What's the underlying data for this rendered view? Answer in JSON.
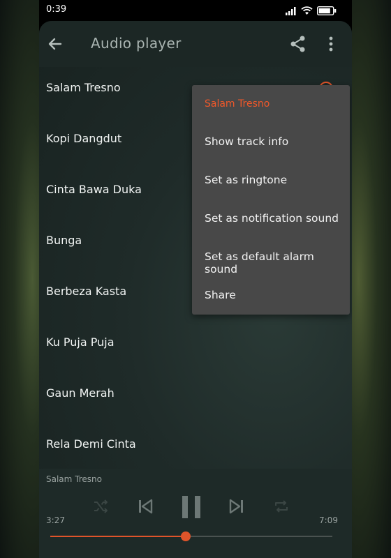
{
  "status_bar": {
    "time": "0:39",
    "icons": [
      "signal-icon",
      "wifi-icon",
      "battery-icon"
    ]
  },
  "toolbar": {
    "title": "Audio player",
    "icons": [
      "back-arrow-icon",
      "share-icon",
      "more-vert-icon"
    ]
  },
  "tracks": [
    {
      "title": "Salam Tresno"
    },
    {
      "title": "Kopi Dangdut"
    },
    {
      "title": "Cinta Bawa Duka"
    },
    {
      "title": "Bunga"
    },
    {
      "title": "Berbeza Kasta"
    },
    {
      "title": "Ku Puja Puja"
    },
    {
      "title": "Gaun Merah"
    },
    {
      "title": "Rela Demi Cinta"
    }
  ],
  "context_menu": {
    "header": "Salam Tresno",
    "items": [
      "Show track info",
      "Set as ringtone",
      "Set as notification sound",
      "Set as default alarm sound",
      "Share"
    ]
  },
  "player": {
    "now_playing": "Salam Tresno",
    "elapsed": "3:27",
    "total": "7:09",
    "progress": 0.48,
    "controls": [
      "shuffle-icon",
      "previous-icon",
      "pause-icon",
      "next-icon",
      "repeat-icon"
    ]
  },
  "colors": {
    "accent": "#e0542a",
    "menu_bg": "#484848",
    "toolbar_bg": "#1c2725"
  }
}
